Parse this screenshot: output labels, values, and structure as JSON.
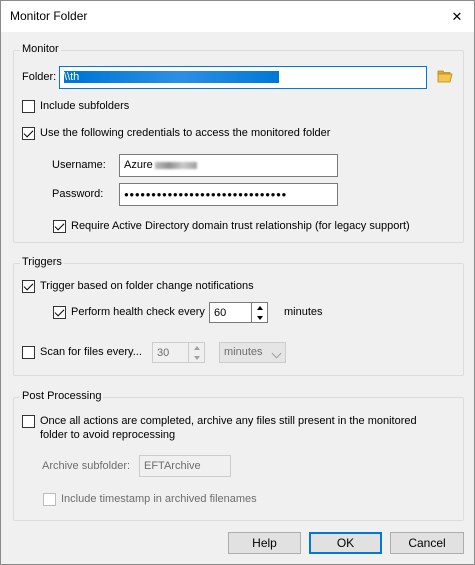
{
  "window": {
    "title": "Monitor Folder",
    "close_glyph": "✕"
  },
  "monitor": {
    "group_label": "Monitor",
    "folder_label": "Folder:",
    "folder_value": "\\\\th",
    "folder_browse_icon": "folder-open-icon",
    "include_subfolders_label": "Include subfolders",
    "include_subfolders_checked": false,
    "use_credentials_label": "Use the following credentials to access the monitored folder",
    "use_credentials_checked": true,
    "username_label": "Username:",
    "username_value": "Azure",
    "password_label": "Password:",
    "password_value": "●●●●●●●●●●●●●●●●●●●●●●●●●●●●●●",
    "require_ad_label": "Require Active Directory domain trust relationship (for legacy support)",
    "require_ad_checked": true
  },
  "triggers": {
    "group_label": "Triggers",
    "change_notifications_label": "Trigger based on folder change notifications",
    "change_notifications_checked": true,
    "health_check_label": "Perform health check every",
    "health_check_checked": true,
    "health_check_value": "60",
    "health_check_unit": "minutes",
    "scan_label": "Scan for files every...",
    "scan_checked": false,
    "scan_value": "30",
    "scan_unit_selected": "minutes"
  },
  "post_processing": {
    "group_label": "Post Processing",
    "archive_label_line1": "Once all actions are completed, archive any files still present in the monitored",
    "archive_label_line2": "folder to avoid reprocessing",
    "archive_checked": false,
    "archive_subfolder_label": "Archive subfolder:",
    "archive_subfolder_value": "EFTArchive",
    "timestamp_label": "Include timestamp in archived filenames",
    "timestamp_checked": false
  },
  "buttons": {
    "help": "Help",
    "ok": "OK",
    "cancel": "Cancel"
  },
  "colors": {
    "accent": "#0078d7",
    "window_bg": "#f0f0f0",
    "folder_icon": "#e0a82e"
  }
}
